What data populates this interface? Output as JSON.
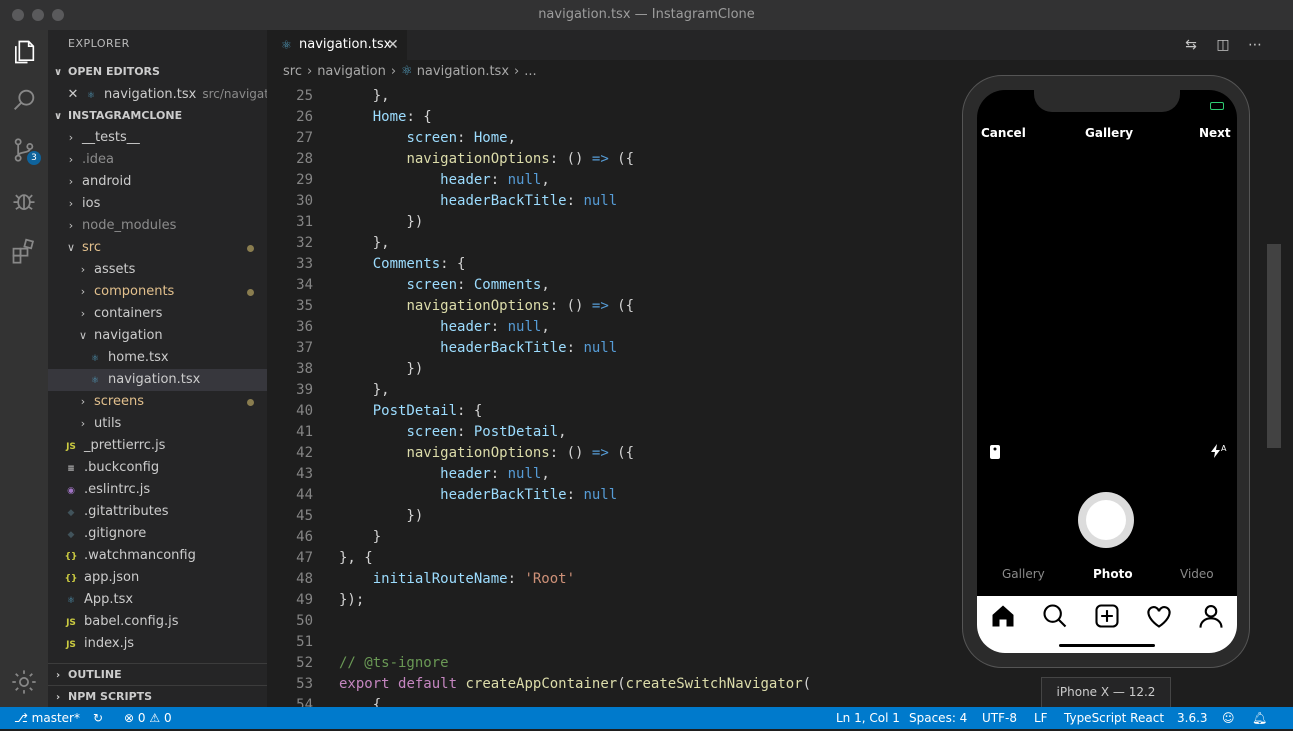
{
  "window": {
    "title": "navigation.tsx — InstagramClone"
  },
  "activity_bar": {
    "scm_badge": "3"
  },
  "sidebar": {
    "title": "EXPLORER",
    "open_editors": {
      "header": "OPEN EDITORS",
      "items": [
        {
          "name": "navigation.tsx",
          "path": "src/navigat..."
        }
      ]
    },
    "project": {
      "header": "INSTAGRAMCLONE",
      "items": [
        {
          "label": "__tests__",
          "type": "folder",
          "depth": 0,
          "expanded": false
        },
        {
          "label": ".idea",
          "type": "folder",
          "depth": 0,
          "expanded": false
        },
        {
          "label": "android",
          "type": "folder",
          "depth": 0,
          "expanded": false
        },
        {
          "label": "ios",
          "type": "folder",
          "depth": 0,
          "expanded": false
        },
        {
          "label": "node_modules",
          "type": "folder",
          "depth": 0,
          "expanded": false
        },
        {
          "label": "src",
          "type": "folder",
          "depth": 0,
          "expanded": true,
          "modified": true
        },
        {
          "label": "assets",
          "type": "folder",
          "depth": 1,
          "expanded": false
        },
        {
          "label": "components",
          "type": "folder",
          "depth": 1,
          "expanded": false,
          "modified": true
        },
        {
          "label": "containers",
          "type": "folder",
          "depth": 1,
          "expanded": false
        },
        {
          "label": "navigation",
          "type": "folder",
          "depth": 1,
          "expanded": true
        },
        {
          "label": "home.tsx",
          "type": "react",
          "depth": 2
        },
        {
          "label": "navigation.tsx",
          "type": "react",
          "depth": 2,
          "selected": true
        },
        {
          "label": "screens",
          "type": "folder",
          "depth": 1,
          "expanded": false,
          "modified": true
        },
        {
          "label": "utils",
          "type": "folder",
          "depth": 1,
          "expanded": false
        },
        {
          "label": "_prettierrc.js",
          "type": "js",
          "depth": 0
        },
        {
          "label": ".buckconfig",
          "type": "config",
          "depth": 0
        },
        {
          "label": ".eslintrc.js",
          "type": "eslint",
          "depth": 0
        },
        {
          "label": ".gitattributes",
          "type": "git",
          "depth": 0
        },
        {
          "label": ".gitignore",
          "type": "git",
          "depth": 0
        },
        {
          "label": ".watchmanconfig",
          "type": "json",
          "depth": 0
        },
        {
          "label": "app.json",
          "type": "json",
          "depth": 0
        },
        {
          "label": "App.tsx",
          "type": "react",
          "depth": 0
        },
        {
          "label": "babel.config.js",
          "type": "js",
          "depth": 0
        },
        {
          "label": "index.js",
          "type": "js",
          "depth": 0
        }
      ]
    },
    "outline_header": "OUTLINE",
    "npm_header": "NPM SCRIPTS"
  },
  "editor": {
    "tab": {
      "label": "navigation.tsx"
    },
    "breadcrumb": [
      "src",
      "navigation",
      "navigation.tsx",
      "..."
    ],
    "lines": [
      {
        "n": "25",
        "tokens": [
          [
            "    },",
            ""
          ]
        ]
      },
      {
        "n": "26",
        "tokens": [
          [
            "    ",
            ""
          ],
          [
            "Home",
            "p"
          ],
          [
            ": {",
            ""
          ]
        ]
      },
      {
        "n": "27",
        "tokens": [
          [
            "        ",
            ""
          ],
          [
            "screen",
            "p"
          ],
          [
            ": ",
            ""
          ],
          [
            "Home",
            "p"
          ],
          [
            ",",
            ""
          ]
        ]
      },
      {
        "n": "28",
        "tokens": [
          [
            "        ",
            ""
          ],
          [
            "navigationOptions",
            "f"
          ],
          [
            ": () ",
            ""
          ],
          [
            "=>",
            "b"
          ],
          [
            " ({",
            ""
          ]
        ]
      },
      {
        "n": "29",
        "tokens": [
          [
            "            ",
            ""
          ],
          [
            "header",
            "p"
          ],
          [
            ": ",
            ""
          ],
          [
            "null",
            "b"
          ],
          [
            ",",
            ""
          ]
        ]
      },
      {
        "n": "30",
        "tokens": [
          [
            "            ",
            ""
          ],
          [
            "headerBackTitle",
            "p"
          ],
          [
            ": ",
            ""
          ],
          [
            "null",
            "b"
          ]
        ]
      },
      {
        "n": "31",
        "tokens": [
          [
            "        })",
            ""
          ]
        ]
      },
      {
        "n": "32",
        "tokens": [
          [
            "    },",
            ""
          ]
        ]
      },
      {
        "n": "33",
        "tokens": [
          [
            "    ",
            ""
          ],
          [
            "Comments",
            "p"
          ],
          [
            ": {",
            ""
          ]
        ]
      },
      {
        "n": "34",
        "tokens": [
          [
            "        ",
            ""
          ],
          [
            "screen",
            "p"
          ],
          [
            ": ",
            ""
          ],
          [
            "Comments",
            "p"
          ],
          [
            ",",
            ""
          ]
        ]
      },
      {
        "n": "35",
        "tokens": [
          [
            "        ",
            ""
          ],
          [
            "navigationOptions",
            "f"
          ],
          [
            ": () ",
            ""
          ],
          [
            "=>",
            "b"
          ],
          [
            " ({",
            ""
          ]
        ]
      },
      {
        "n": "36",
        "tokens": [
          [
            "            ",
            ""
          ],
          [
            "header",
            "p"
          ],
          [
            ": ",
            ""
          ],
          [
            "null",
            "b"
          ],
          [
            ",",
            ""
          ]
        ]
      },
      {
        "n": "37",
        "tokens": [
          [
            "            ",
            ""
          ],
          [
            "headerBackTitle",
            "p"
          ],
          [
            ": ",
            ""
          ],
          [
            "null",
            "b"
          ]
        ]
      },
      {
        "n": "38",
        "tokens": [
          [
            "        })",
            ""
          ]
        ]
      },
      {
        "n": "39",
        "tokens": [
          [
            "    },",
            ""
          ]
        ]
      },
      {
        "n": "40",
        "tokens": [
          [
            "    ",
            ""
          ],
          [
            "PostDetail",
            "p"
          ],
          [
            ": {",
            ""
          ]
        ]
      },
      {
        "n": "41",
        "tokens": [
          [
            "        ",
            ""
          ],
          [
            "screen",
            "p"
          ],
          [
            ": ",
            ""
          ],
          [
            "PostDetail",
            "p"
          ],
          [
            ",",
            ""
          ]
        ]
      },
      {
        "n": "42",
        "tokens": [
          [
            "        ",
            ""
          ],
          [
            "navigationOptions",
            "f"
          ],
          [
            ": () ",
            ""
          ],
          [
            "=>",
            "b"
          ],
          [
            " ({",
            ""
          ]
        ]
      },
      {
        "n": "43",
        "tokens": [
          [
            "            ",
            ""
          ],
          [
            "header",
            "p"
          ],
          [
            ": ",
            ""
          ],
          [
            "null",
            "b"
          ],
          [
            ",",
            ""
          ]
        ]
      },
      {
        "n": "44",
        "tokens": [
          [
            "            ",
            ""
          ],
          [
            "headerBackTitle",
            "p"
          ],
          [
            ": ",
            ""
          ],
          [
            "null",
            "b"
          ]
        ]
      },
      {
        "n": "45",
        "tokens": [
          [
            "        })",
            ""
          ]
        ]
      },
      {
        "n": "46",
        "tokens": [
          [
            "    }",
            ""
          ]
        ]
      },
      {
        "n": "47",
        "tokens": [
          [
            "}, {",
            ""
          ]
        ]
      },
      {
        "n": "48",
        "tokens": [
          [
            "    ",
            ""
          ],
          [
            "initialRouteName",
            "p"
          ],
          [
            ": ",
            ""
          ],
          [
            "'Root'",
            "s"
          ]
        ]
      },
      {
        "n": "49",
        "tokens": [
          [
            "});",
            ""
          ]
        ]
      },
      {
        "n": "50",
        "tokens": []
      },
      {
        "n": "51",
        "tokens": []
      },
      {
        "n": "52",
        "tokens": [
          [
            "// @ts-ignore",
            "c"
          ]
        ]
      },
      {
        "n": "53",
        "tokens": [
          [
            "export",
            "k"
          ],
          [
            " ",
            ""
          ],
          [
            "default",
            "k"
          ],
          [
            " ",
            ""
          ],
          [
            "createAppContainer",
            "f"
          ],
          [
            "(",
            ""
          ],
          [
            "createSwitchNavigator",
            "f"
          ],
          [
            "(",
            ""
          ]
        ]
      },
      {
        "n": "54",
        "tokens": [
          [
            "    {",
            ""
          ]
        ]
      }
    ]
  },
  "simulator": {
    "top_left": "Cancel",
    "top_title": "Gallery",
    "top_right": "Next",
    "flash_label": "A",
    "modes": [
      "Gallery",
      "Photo",
      "Video"
    ],
    "active_mode": "Photo",
    "tabs": [
      "home-icon",
      "search-icon",
      "plus-square-icon",
      "heart-icon",
      "user-icon"
    ],
    "device_tooltip": "iPhone X — 12.2"
  },
  "statusbar": {
    "branch": "master*",
    "errors": "0",
    "warnings": "0",
    "cursor": "Ln 1, Col 1",
    "spaces": "Spaces: 4",
    "encoding": "UTF-8",
    "eol": "LF",
    "language": "TypeScript React",
    "version": "3.6.3"
  },
  "colors": {
    "accent": "#007acc",
    "modified_dot": "#8a7d4f",
    "folder_modified": "#e2c08d"
  }
}
